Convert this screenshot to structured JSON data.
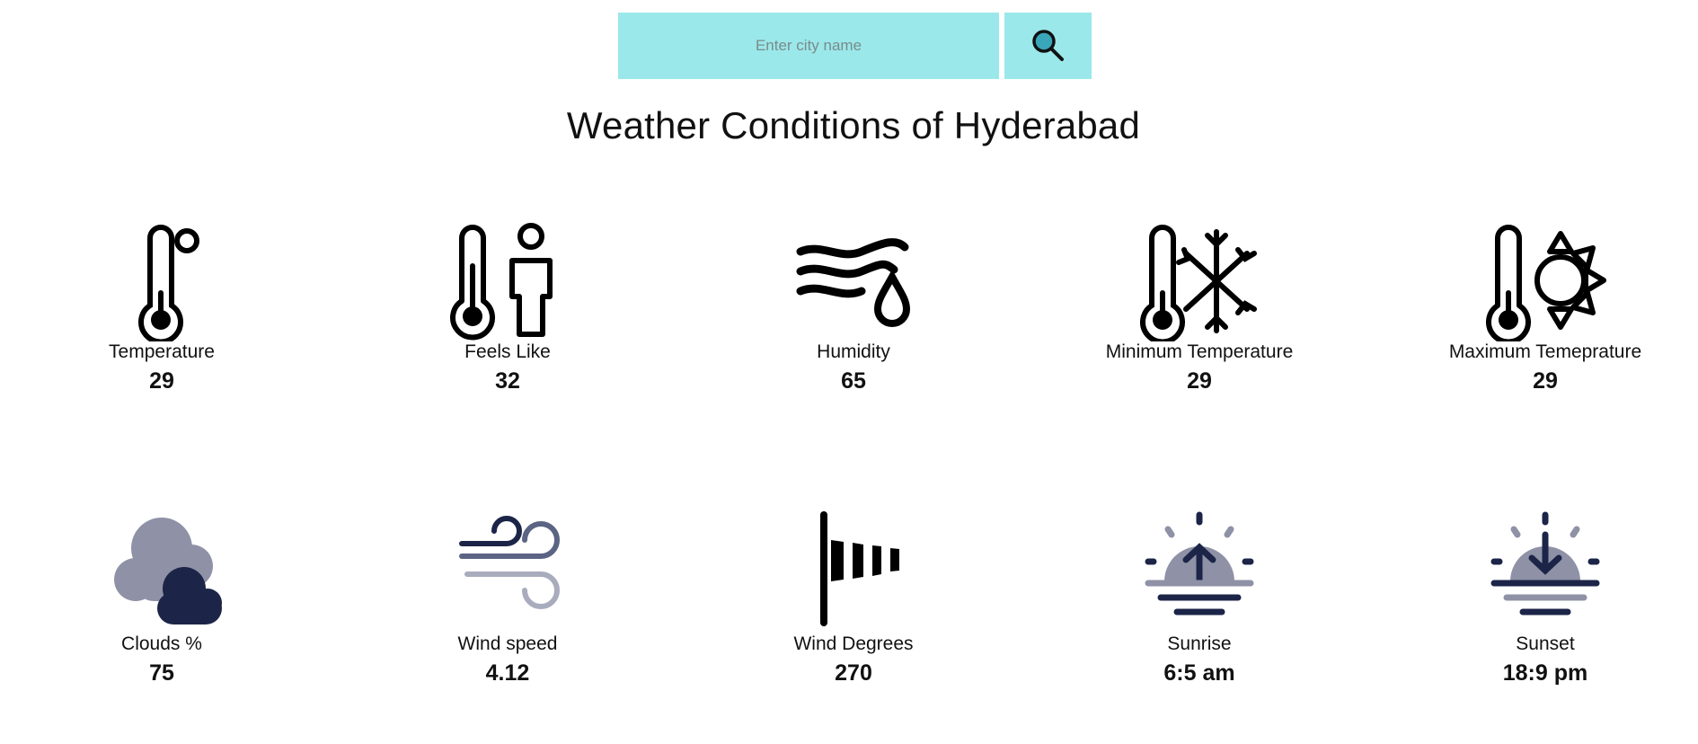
{
  "search": {
    "placeholder": "Enter city name",
    "value": ""
  },
  "title": "Weather Conditions of Hyderabad",
  "colors": {
    "search_bg": "#9be8ea",
    "icon_dark": "#1c2548",
    "icon_gray": "#8f92a6",
    "search_glass_fill": "#3aa6b9"
  },
  "metrics": [
    {
      "label": "Temperature",
      "value": "29",
      "icon": "thermometer-icon"
    },
    {
      "label": "Feels Like",
      "value": "32",
      "icon": "thermometer-person-icon"
    },
    {
      "label": "Humidity",
      "value": "65",
      "icon": "humidity-icon"
    },
    {
      "label": "Minimum Temperature",
      "value": "29",
      "icon": "thermometer-snowflake-icon"
    },
    {
      "label": "Maximum Temeprature",
      "value": "29",
      "icon": "thermometer-sun-icon"
    },
    {
      "label": "Clouds %",
      "value": "75",
      "icon": "clouds-icon"
    },
    {
      "label": "Wind speed",
      "value": "4.12",
      "icon": "wind-icon"
    },
    {
      "label": "Wind Degrees",
      "value": "270",
      "icon": "windsock-icon"
    },
    {
      "label": "Sunrise",
      "value": "6:5 am",
      "icon": "sunrise-icon"
    },
    {
      "label": "Sunset",
      "value": "18:9 pm",
      "icon": "sunset-icon"
    }
  ]
}
